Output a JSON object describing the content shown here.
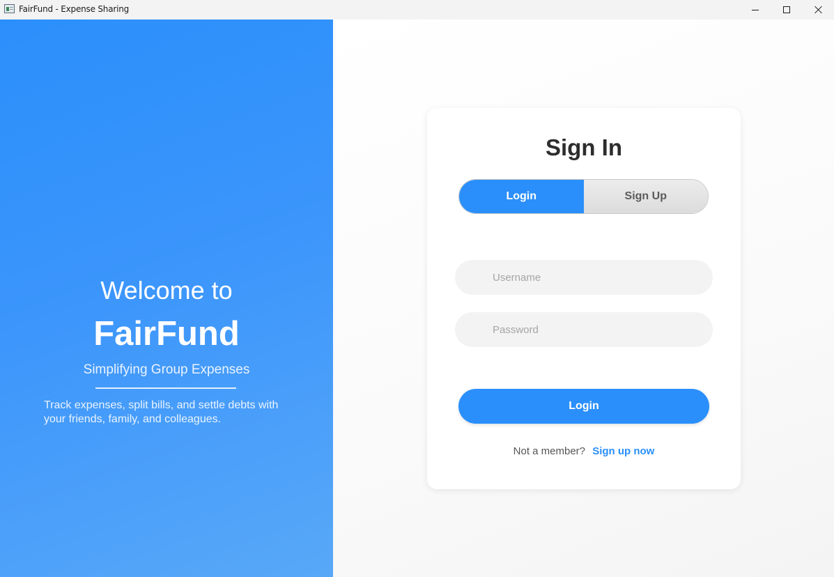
{
  "window": {
    "title": "FairFund - Expense Sharing",
    "icon": "app-icon"
  },
  "hero": {
    "welcome": "Welcome to",
    "brand": "FairFund",
    "tagline": "Simplifying Group Expenses",
    "description": "Track expenses, split bills, and settle debts with your friends, family, and colleagues."
  },
  "card": {
    "title": "Sign In",
    "tabs": [
      {
        "label": "Login",
        "active": true
      },
      {
        "label": "Sign Up",
        "active": false
      }
    ],
    "username": {
      "value": "",
      "placeholder": "Username"
    },
    "password": {
      "value": "",
      "placeholder": "Password"
    },
    "submit_label": "Login",
    "signup_prompt": "Not a member?",
    "signup_link": "Sign up now"
  },
  "colors": {
    "accent": "#2b8ffb",
    "field_bg": "#f3f3f3",
    "title_text": "#2d2d2d"
  }
}
